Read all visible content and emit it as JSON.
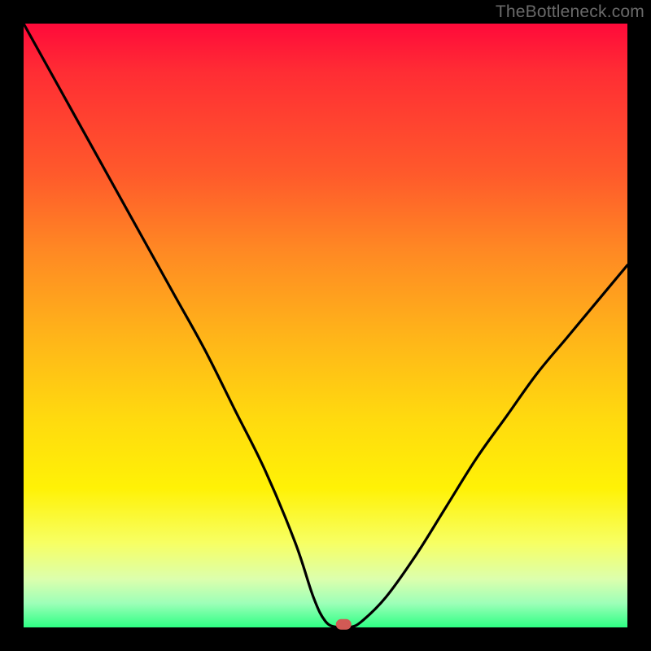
{
  "watermark": "TheBottleneck.com",
  "chart_data": {
    "type": "line",
    "title": "",
    "xlabel": "",
    "ylabel": "",
    "xlim": [
      0,
      100
    ],
    "ylim": [
      0,
      100
    ],
    "background_gradient": {
      "orientation": "vertical",
      "top_color": "#ff0a3a",
      "bottom_color": "#2eff84",
      "description": "Red (top / high bottleneck) → yellow → green (bottom / low bottleneck)"
    },
    "series": [
      {
        "name": "bottleneck-curve",
        "x": [
          0,
          5,
          10,
          15,
          20,
          25,
          30,
          35,
          40,
          45,
          48,
          50,
          52,
          54,
          56,
          60,
          65,
          70,
          75,
          80,
          85,
          90,
          95,
          100
        ],
        "y": [
          100,
          91,
          82,
          73,
          64,
          55,
          46,
          36,
          26,
          14,
          5,
          1,
          0,
          0,
          1,
          5,
          12,
          20,
          28,
          35,
          42,
          48,
          54,
          60
        ]
      }
    ],
    "marker": {
      "x": 53,
      "y": 0.5,
      "label": "optimal-point"
    }
  }
}
